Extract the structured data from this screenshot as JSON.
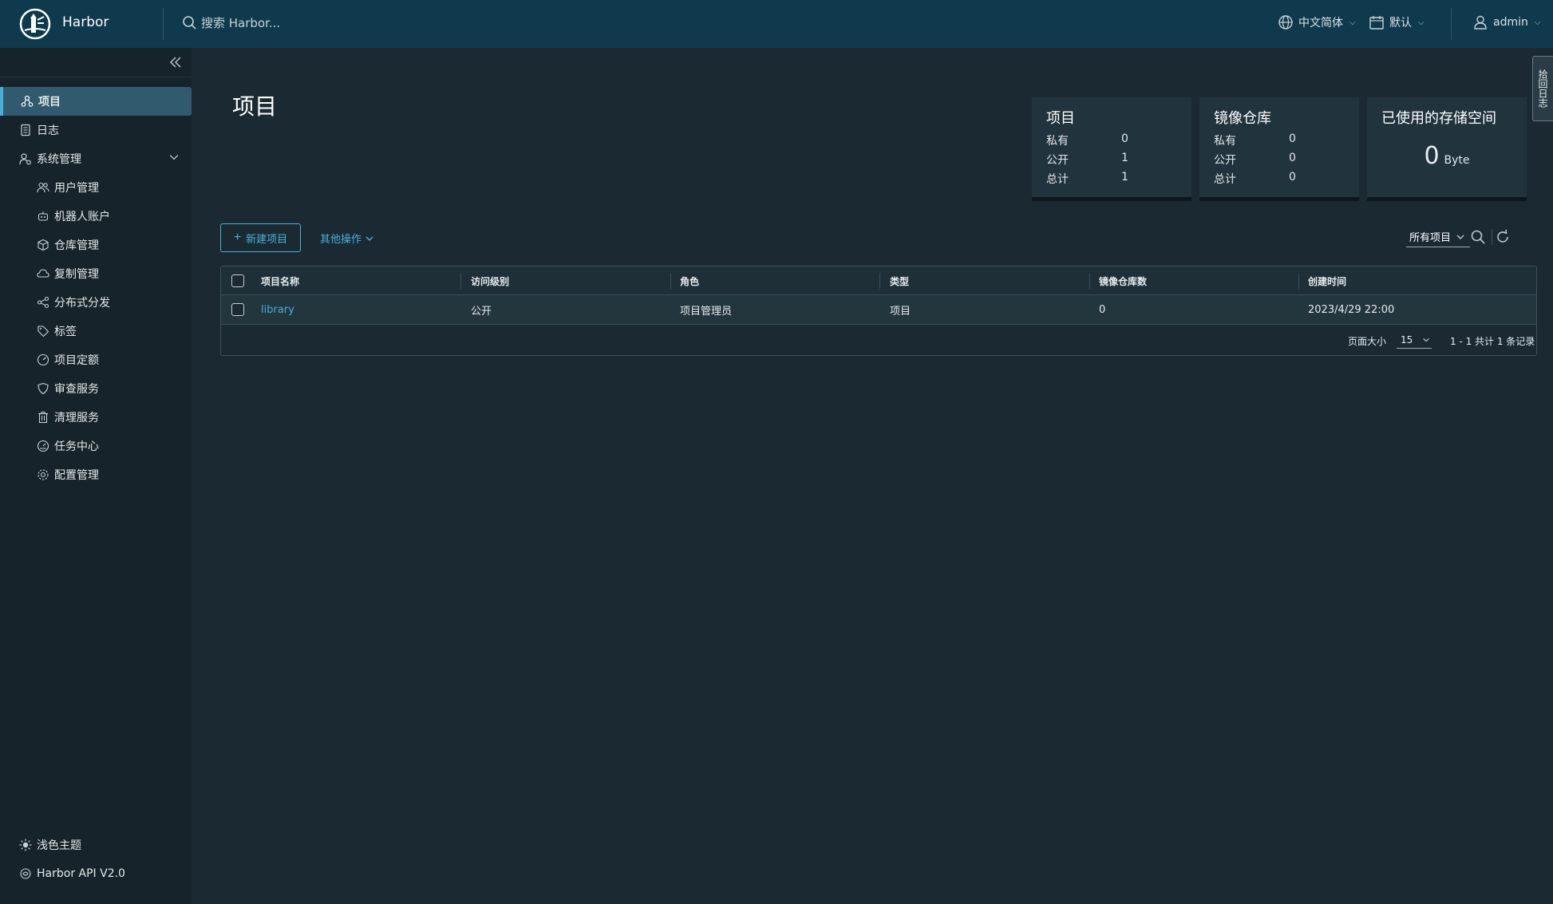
{
  "header": {
    "app_title": "Harbor",
    "search_placeholder": "搜索 Harbor...",
    "language": "中文简体",
    "datetime_format": "默认",
    "user": "admin"
  },
  "sidebar": {
    "items": [
      {
        "label": "项目",
        "icon": "projects-icon",
        "active": true
      },
      {
        "label": "日志",
        "icon": "logs-icon"
      },
      {
        "label": "系统管理",
        "icon": "admin-icon",
        "expanded": true
      }
    ],
    "sub_items": [
      {
        "label": "用户管理",
        "icon": "users-icon"
      },
      {
        "label": "机器人账户",
        "icon": "robot-icon"
      },
      {
        "label": "仓库管理",
        "icon": "registry-icon"
      },
      {
        "label": "复制管理",
        "icon": "replication-icon"
      },
      {
        "label": "分布式分发",
        "icon": "distribution-icon"
      },
      {
        "label": "标签",
        "icon": "tag-icon"
      },
      {
        "label": "项目定额",
        "icon": "quota-icon"
      },
      {
        "label": "审查服务",
        "icon": "shield-icon"
      },
      {
        "label": "清理服务",
        "icon": "trash-icon"
      },
      {
        "label": "任务中心",
        "icon": "dashboard-icon"
      },
      {
        "label": "配置管理",
        "icon": "gear-icon"
      }
    ],
    "bottom": [
      {
        "label": "浅色主题",
        "icon": "sun-icon"
      },
      {
        "label": "Harbor API V2.0",
        "icon": "api-icon"
      }
    ]
  },
  "main": {
    "title": "项目",
    "cards": {
      "projects": {
        "title": "项目",
        "rows": [
          {
            "label": "私有",
            "value": "0"
          },
          {
            "label": "公开",
            "value": "1"
          },
          {
            "label": "总计",
            "value": "1"
          }
        ]
      },
      "repositories": {
        "title": "镜像仓库",
        "rows": [
          {
            "label": "私有",
            "value": "0"
          },
          {
            "label": "公开",
            "value": "0"
          },
          {
            "label": "总计",
            "value": "0"
          }
        ]
      },
      "storage": {
        "title": "已使用的存储空间",
        "value": "0",
        "unit": "Byte"
      }
    },
    "toolbar": {
      "new_project": "新建项目",
      "other_actions": "其他操作",
      "filter": "所有项目"
    },
    "table": {
      "columns": [
        "项目名称",
        "访问级别",
        "角色",
        "类型",
        "镜像仓库数",
        "创建时间"
      ],
      "rows": [
        [
          "library",
          "公开",
          "项目管理员",
          "项目",
          "0",
          "2023/4/29 22:00"
        ]
      ],
      "footer": {
        "page_size_label": "页面大小",
        "page_size": "15",
        "page_info": "1 - 1 共计 1 条记录"
      }
    },
    "side_tab": "拾回日志"
  }
}
